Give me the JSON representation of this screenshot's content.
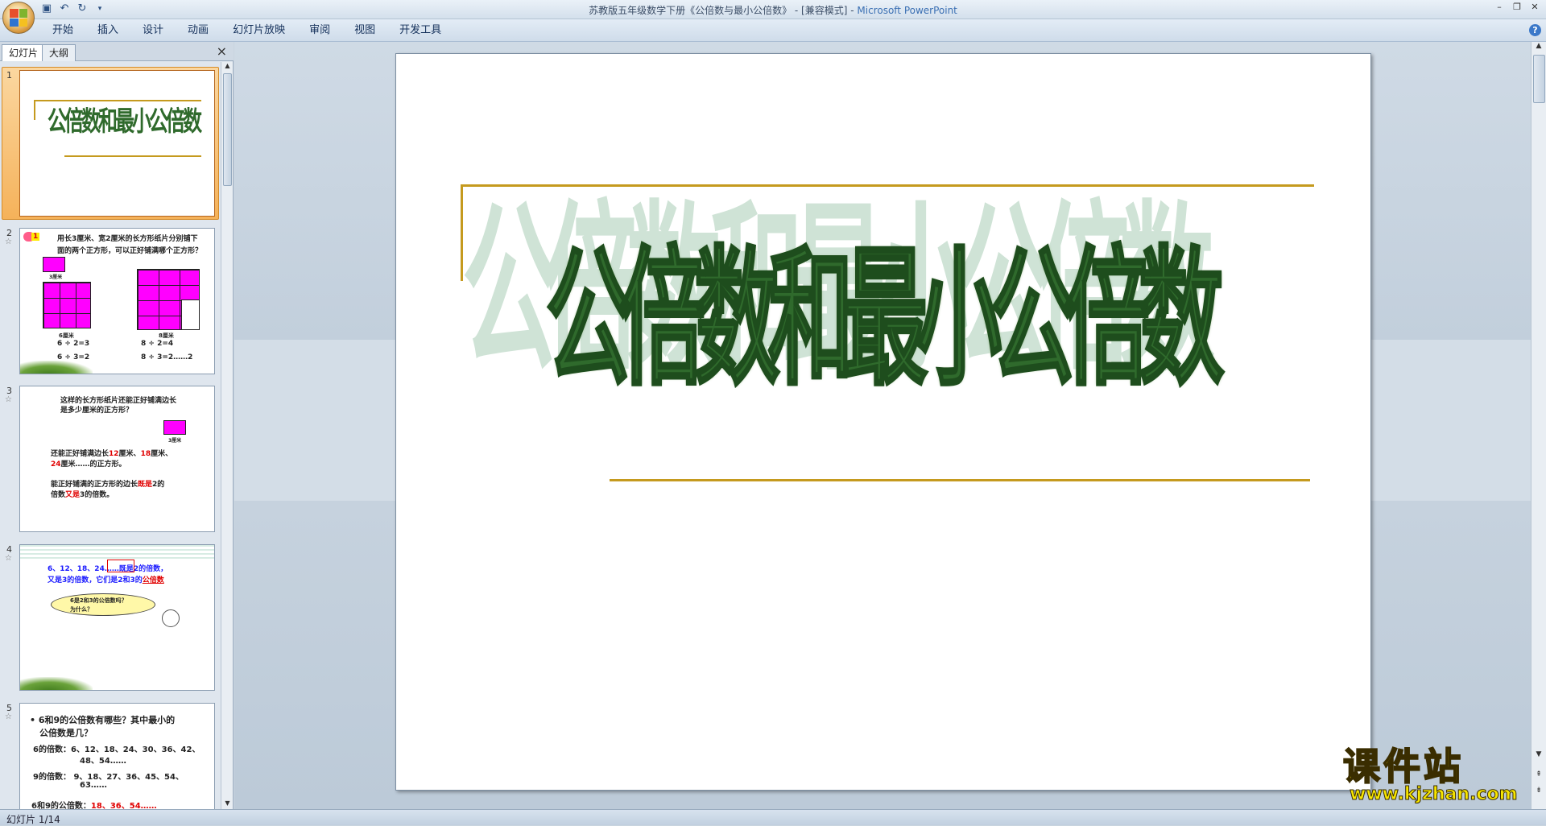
{
  "window": {
    "title_main": "苏教版五年级数学下册《公倍数与最小公倍数》 - [兼容模式] - ",
    "title_app": "Microsoft PowerPoint"
  },
  "quick_access": {
    "save_icon": "save-icon",
    "undo_icon": "undo-icon",
    "redo_icon": "redo-icon",
    "customize_icon": "customize-icon"
  },
  "ribbon": {
    "tabs": [
      "开始",
      "插入",
      "设计",
      "动画",
      "幻灯片放映",
      "审阅",
      "视图",
      "开发工具"
    ]
  },
  "pane": {
    "tab_slides": "幻灯片",
    "tab_outline": "大纲",
    "close": "×"
  },
  "thumbnails": [
    {
      "num": "1",
      "title": "公倍数和最小公倍数"
    },
    {
      "num": "2",
      "badge": "1",
      "text1": "用长3厘米、宽2厘米的长方形纸片分别铺下",
      "text2": "面的两个正方形，可以正好铺满哪个正方形？",
      "small_label": "3厘米",
      "left_label": "6厘米",
      "right_label": "8厘米",
      "eq1": "6 ÷ 2=3",
      "eq2": "6 ÷ 3=2",
      "eq3": "8 ÷ 2=4",
      "eq4": "8 ÷ 3=2……2"
    },
    {
      "num": "3",
      "line1": "这样的长方形纸片还能正好铺满边长",
      "line2": "是多少厘米的正方形？",
      "small_label": "3厘米",
      "para1a": "还能正好铺满边长",
      "n12": "12",
      "para1b": "厘米、",
      "n18": "18",
      "para1c": "厘米、",
      "n24": "24",
      "para1d": "厘米……的正方形。",
      "para2a": "能正好铺满的正方形的边长",
      "both": "既是",
      "para2b": "2的",
      "para2c": "倍数",
      "also": "又是",
      "para2d": "3的倍数。"
    },
    {
      "num": "4",
      "line1": "6、12、18、24……既是2的倍数，",
      "line2a": "又是3的倍数，它们是2和3的",
      "line2b": "公倍数",
      "bubble1": "6是2和3的公倍数吗？",
      "bubble2": "为什么？"
    },
    {
      "num": "5",
      "q1": "• 6和9的公倍数有哪些？其中最小的",
      "q2": "公倍数是几？",
      "a1": "6的倍数：6、12、18、24、30、36、42、",
      "a1b": "48、54……",
      "a2": "9的倍数： 9、18、27、36、45、54、",
      "a2b": "63……",
      "a3": "6和9的公倍数：",
      "a3v": "18、36、54……"
    }
  ],
  "main_slide": {
    "title": "公倍数和最小公倍数"
  },
  "status": {
    "text": "幻灯片 1/14"
  },
  "watermark": {
    "line1": "课件站",
    "line2": "www.kjzhan.com"
  },
  "colors": {
    "title_green": "#2f6a2c",
    "shadow_green": "#cfe3d6",
    "gold_line": "#c59a1e",
    "magenta": "#ff00ff",
    "red": "#e00000",
    "blue": "#1a1aff"
  }
}
